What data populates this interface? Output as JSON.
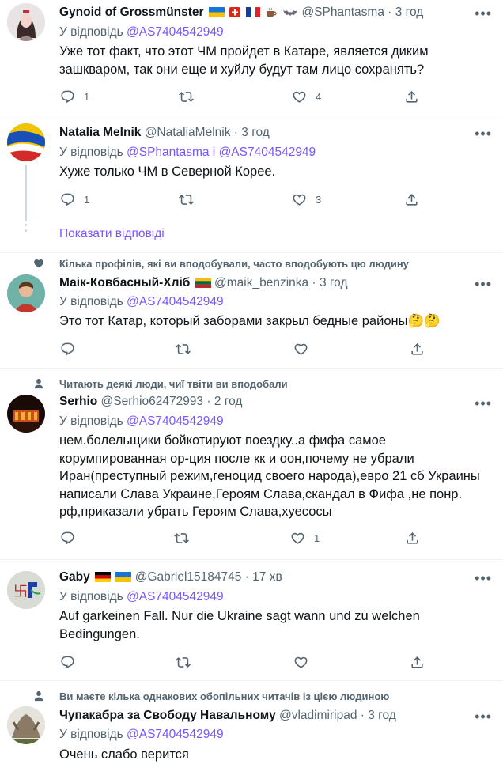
{
  "reply_prefix": "У відповідь",
  "tweets": [
    {
      "name": "Gynoid of Grossmünster",
      "handle": "@SPhantasma",
      "time": "3 год",
      "reply_to": [
        "@AS7404542949"
      ],
      "text": "Уже тот факт, что этот ЧМ пройдет в Катаре, является диким зашкваром, так они еще и хуйлу будут там лицо сохранять?",
      "replies": "1",
      "retweets": "",
      "likes": "4"
    },
    {
      "name": "Natalia Melnik",
      "handle": "@NataliaMelnik",
      "time": "3 год",
      "reply_to": [
        "@SPhantasma",
        "@AS7404542949"
      ],
      "reply_joiner": "і",
      "text": "Хуже только ЧМ в Северной Корее.",
      "replies": "1",
      "retweets": "",
      "likes": "3"
    },
    {
      "social": "Кілька профілів, які ви вподобували, часто вподобують цю людину",
      "name": "Маік-Ковбасный-Хліб",
      "handle": "@maik_benzinka",
      "time": "3 год",
      "reply_to": [
        "@AS7404542949"
      ],
      "text": "Это тот Катар, который заборами закрыл бедные районы🤔🤔",
      "replies": "",
      "retweets": "",
      "likes": ""
    },
    {
      "social": "Читають деякі люди, чиї твіти ви вподобали",
      "name": "Serhio",
      "handle": "@Serhio62472993",
      "time": "2 год",
      "reply_to": [
        "@AS7404542949"
      ],
      "text": "нем.болельщики бойкотируют поездку..а фифа самое корумпированная ор-ция после кк и оон,почему не убрали Иран(преступный режим,геноцид своего народа),евро 21 сб Украины написали Слава Украине,Героям Слава,скандал в Фифа ,не понр. рф,приказали убрать Героям Слава,хуесосы",
      "replies": "",
      "retweets": "",
      "likes": "1"
    },
    {
      "name": "Gaby",
      "handle": "@Gabriel15184745",
      "time": "17 хв",
      "reply_to": [
        "@AS7404542949"
      ],
      "text": "Auf garkeinen Fall.  Nur die Ukraine sagt wann und zu welchen Bedingungen.",
      "replies": "",
      "retweets": "",
      "likes": ""
    },
    {
      "social": "Ви маєте кілька однакових обопільних читачів із цією людиною",
      "name": "Чупакабра за Свободу Навальному",
      "handle": "@vladimiripad",
      "time": "3 год",
      "reply_to": [
        "@AS7404542949"
      ],
      "text": "Очень слабо верится",
      "replies": "",
      "retweets": "",
      "likes": ""
    }
  ],
  "show_replies": "Показати відповіді",
  "dot": "·",
  "more_glyph": "•••",
  "colors": {
    "link": "#7856ff",
    "secondary": "#536471",
    "text": "#0f1419",
    "divider": "#eff3f4"
  },
  "icons": [
    "reply-icon",
    "retweet-icon",
    "like-icon",
    "share-icon",
    "more-icon",
    "heart-social-icon",
    "person-social-icon"
  ]
}
